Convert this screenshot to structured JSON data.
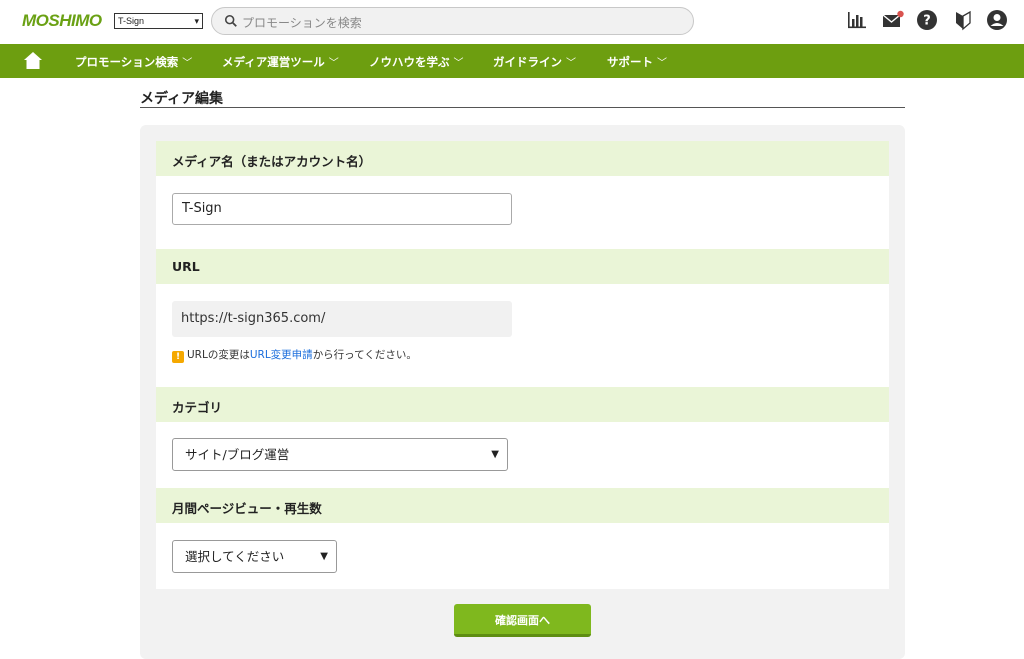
{
  "header": {
    "logo_main": "MOSHIMO",
    "media_select": "T-Sign",
    "search_placeholder": "プロモーションを検索",
    "icons": [
      "report-chart-icon",
      "mail-icon",
      "help-icon",
      "beginner-icon",
      "user-icon"
    ]
  },
  "nav": {
    "items": [
      {
        "label": "プロモーション検索"
      },
      {
        "label": "メディア運営ツール"
      },
      {
        "label": "ノウハウを学ぶ"
      },
      {
        "label": "ガイドライン"
      },
      {
        "label": "サポート"
      }
    ],
    "chevron": "﹀"
  },
  "page": {
    "title": "メディア編集"
  },
  "form": {
    "media_name": {
      "label": "メディア名（またはアカウント名）",
      "value": "T-Sign"
    },
    "url": {
      "label": "URL",
      "value": "https://t-sign365.com/",
      "note_prefix": "URLの変更は",
      "note_link": "URL変更申請",
      "note_suffix": "から行ってください。",
      "warn_mark": "!"
    },
    "category": {
      "label": "カテゴリ",
      "value": "サイト/ブログ運営"
    },
    "pageviews": {
      "label": "月間ページビュー・再生数",
      "value": "選択してください"
    },
    "submit_label": "確認画面へ"
  },
  "colors": {
    "brand_green": "#6d9e10",
    "section_bg": "#eaf5d7",
    "button_green": "#7fb81e",
    "link_blue": "#1a6ddc",
    "warn_orange": "#f5a800"
  }
}
